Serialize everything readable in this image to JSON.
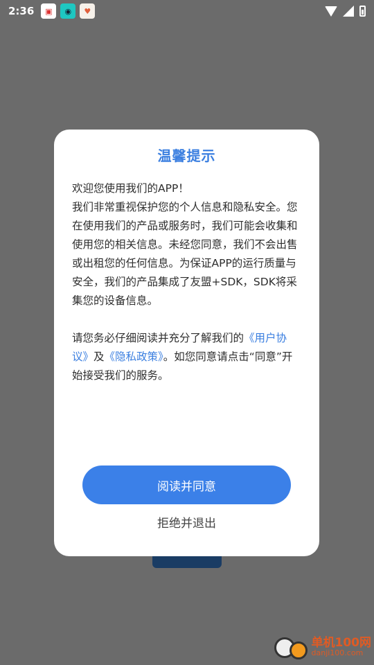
{
  "status_bar": {
    "time": "2:36",
    "notification_icons": [
      "app-notification-icon",
      "robot-app-icon",
      "heart-app-icon"
    ],
    "system_icons": [
      "wifi-icon",
      "signal-icon",
      "battery-icon"
    ]
  },
  "dialog": {
    "title": "温馨提示",
    "paragraph1": "欢迎您使用我们的APP！\n我们非常重视保护您的个人信息和隐私安全。您在使用我们的产品或服务时，我们可能会收集和使用您的相关信息。未经您同意，我们不会出售或出租您的任何信息。为保证APP的运行质量与安全，我们的产品集成了友盟+SDK，SDK将采集您的设备信息。",
    "paragraph2_prefix": "请您务必仔细阅读并充分了解我们的",
    "user_agreement_link": "《用户协议》",
    "paragraph2_and": "及",
    "privacy_policy_link": "《隐私政策》",
    "paragraph2_suffix": "。如您同意请点击“同意”开始接受我们的服务。",
    "agree_button": "阅读并同意",
    "decline_button": "拒绝并退出"
  },
  "watermark": {
    "name": "单机100网",
    "domain": "danji100.com"
  },
  "colors": {
    "accent": "#3b80e8",
    "overlay": "#6b6b6b"
  }
}
